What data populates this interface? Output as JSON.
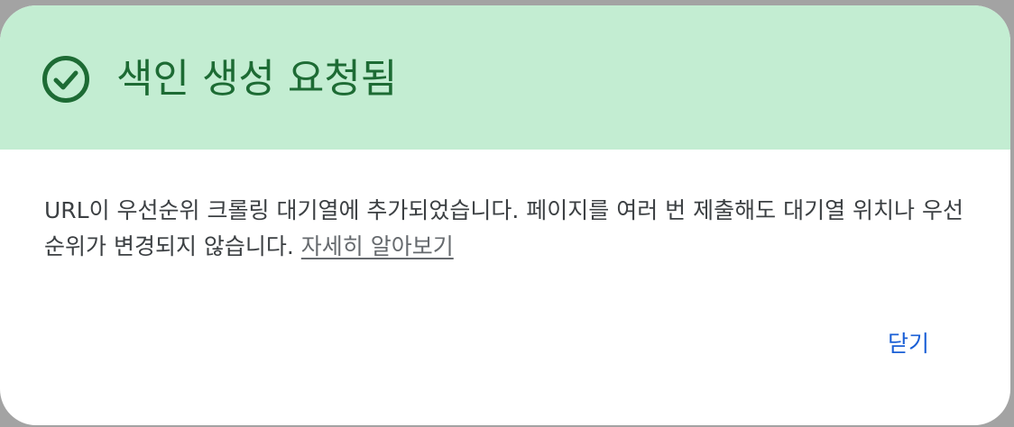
{
  "dialog": {
    "title": "색인 생성 요청됨",
    "title_icon": "check-circle-icon",
    "message": "URL이 우선순위 크롤링 대기열에 추가되었습니다. 페이지를 여러 번 제출해도 대기열 위치나 우선순위가 변경되지 않습니다.",
    "learn_more_label": "자세히 알아보기",
    "close_label": "닫기"
  },
  "colors": {
    "header_background": "#c3edd2",
    "title_text": "#1d6b34",
    "body_text": "#3c4043",
    "link_text": "#666a6e",
    "button_text": "#1a5fd6",
    "backdrop": "#a3a3a3"
  }
}
